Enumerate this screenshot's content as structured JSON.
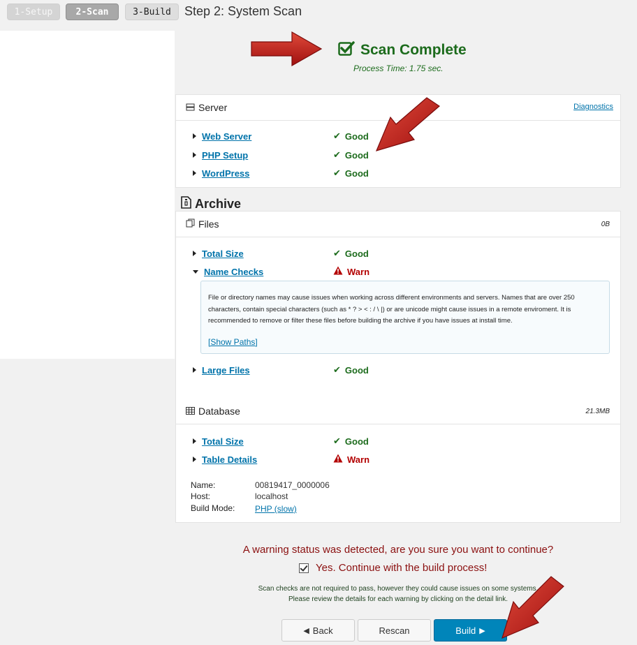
{
  "wizard": {
    "steps": [
      {
        "label": "1-Setup"
      },
      {
        "label": "2-Scan"
      },
      {
        "label": "3-Build"
      }
    ],
    "title": "Step 2: System Scan"
  },
  "scan": {
    "title": "Scan Complete",
    "process_time": "Process Time: 1.75 sec."
  },
  "server": {
    "title": "Server",
    "diagnostics_link": "Diagnostics",
    "checks": [
      {
        "label": "Web Server",
        "status": "Good"
      },
      {
        "label": "PHP Setup",
        "status": "Good"
      },
      {
        "label": "WordPress",
        "status": "Good"
      }
    ]
  },
  "archive": {
    "title": "Archive",
    "files": {
      "title": "Files",
      "size": "0B",
      "checks": [
        {
          "label": "Total Size",
          "status": "Good"
        },
        {
          "label": "Name Checks",
          "status": "Warn"
        },
        {
          "label": "Large Files",
          "status": "Good"
        }
      ],
      "name_checks_details": "File or directory names may cause issues when working across different environments and servers. Names that are over 250 characters, contain special characters (such as * ? > < : / \\ |) or are unicode might cause issues in a remote enviroment. It is recommended to remove or filter these files before building the archive if you have issues at install time.",
      "show_paths": "[Show Paths]"
    },
    "database": {
      "title": "Database",
      "size": "21.3MB",
      "checks": [
        {
          "label": "Total Size",
          "status": "Good"
        },
        {
          "label": "Table Details",
          "status": "Warn"
        }
      ],
      "name_label": "Name:",
      "name_value": "00819417_0000006",
      "host_label": "Host:",
      "host_value": "localhost",
      "build_mode_label": "Build Mode:",
      "build_mode_value": "PHP (slow)"
    }
  },
  "warning": {
    "message": "A warning status was detected, are you sure you want to continue?",
    "confirm_label": "Yes. Continue with the build process!",
    "note_line1": "Scan checks are not required to pass, however they could cause issues on some systems.",
    "note_line2": "Please review the details for each warning by clicking on the detail link."
  },
  "buttons": {
    "back": "Back",
    "rescan": "Rescan",
    "build": "Build"
  },
  "colors": {
    "good": "#1c6b1c",
    "warn": "#b30000",
    "primary": "#0085ba",
    "link": "#0073aa"
  }
}
